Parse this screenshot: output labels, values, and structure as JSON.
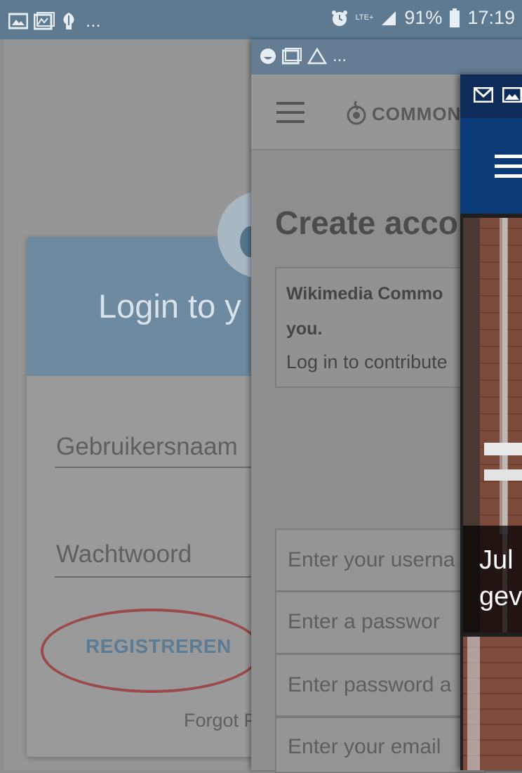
{
  "status_bar": {
    "left_ellipsis": "...",
    "network": "LTE+",
    "battery": "91%",
    "time": "17:19",
    "icons": [
      "image-icon",
      "gallery-icon",
      "fork-icon",
      "alarm-icon",
      "signal-icon",
      "battery-icon"
    ]
  },
  "login_app": {
    "title": "Login to y",
    "username_placeholder": "Gebruikersnaam",
    "password_placeholder": "Wachtwoord",
    "register_label": "REGISTREREN",
    "forgot_label": "Forgot P",
    "accent_color": "#6e8aa0",
    "highlight_oval_color": "#9a4a4a"
  },
  "web_app": {
    "status_ellipsis": "...",
    "logo_text": "COMMON",
    "page_title": "Create acco",
    "notice_line1": "Wikimedia Commo",
    "notice_line2": "you.",
    "notice_line3": "Log in to contribute",
    "inputs": [
      "Enter your userna",
      "Enter a passwor",
      "Enter password a",
      "Enter your email"
    ]
  },
  "news_app": {
    "toolbar_color": "#0a3a78",
    "caption_line1": "Jul",
    "caption_line2": "gev"
  }
}
